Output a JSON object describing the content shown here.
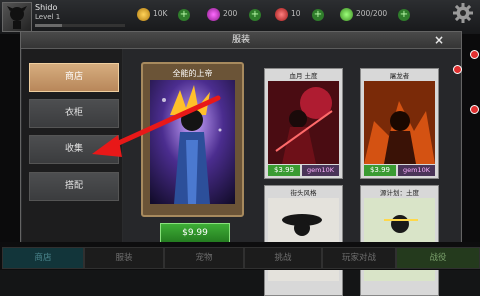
{
  "hud": {
    "player_name": "Shido",
    "player_level": "Level 1",
    "xp_progress": 0.3,
    "gold": "10K",
    "gems": "200",
    "energy": "10",
    "stamina": "200/200"
  },
  "modal": {
    "title": "服装",
    "close": "×",
    "nav": [
      {
        "label": "商店",
        "active": true
      },
      {
        "label": "衣柜",
        "active": false
      },
      {
        "label": "收集",
        "active": false
      },
      {
        "label": "搭配",
        "active": false
      }
    ],
    "featured": {
      "name": "全能的上帝",
      "price": "$9.99"
    },
    "cards": [
      {
        "name": "血月 土度",
        "price": "$3.99",
        "gems": "gem10K"
      },
      {
        "name": "屠龙者",
        "price": "$3.99",
        "gems": "gem10K"
      },
      {
        "name": "街头风格",
        "price": "",
        "gems": ""
      },
      {
        "name": "源计划：土度",
        "price": "",
        "gems": ""
      }
    ]
  },
  "bottom_nav": [
    {
      "label": "商店"
    },
    {
      "label": "服装"
    },
    {
      "label": "宠物"
    },
    {
      "label": "挑战"
    },
    {
      "label": "玩家对战"
    },
    {
      "label": "战役"
    }
  ],
  "colors": {
    "accent_active": "#c89a6a",
    "price_green": "#2f9a27",
    "pointer_red": "#e81818"
  }
}
